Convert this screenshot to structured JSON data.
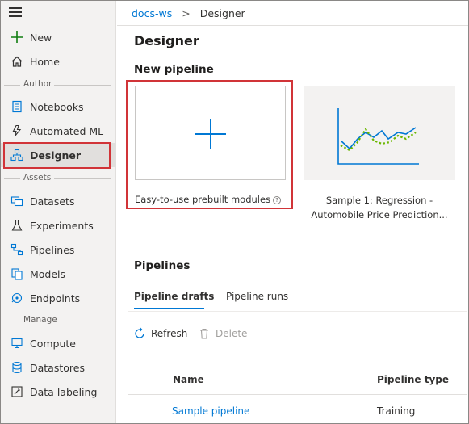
{
  "colors": {
    "accent": "#0078d4",
    "highlight": "#d13438",
    "sidebar_bg": "#f3f2f1",
    "chart_green": "#6bb700"
  },
  "sidebar": {
    "top_items": [
      {
        "label": "New",
        "icon": "plus-icon"
      },
      {
        "label": "Home",
        "icon": "home-icon"
      }
    ],
    "sections": [
      {
        "label": "Author",
        "items": [
          {
            "label": "Notebooks",
            "icon": "notebook-icon"
          },
          {
            "label": "Automated ML",
            "icon": "lightning-icon"
          },
          {
            "label": "Designer",
            "icon": "hierarchy-icon",
            "selected": true
          }
        ]
      },
      {
        "label": "Assets",
        "items": [
          {
            "label": "Datasets",
            "icon": "datasets-icon"
          },
          {
            "label": "Experiments",
            "icon": "flask-icon"
          },
          {
            "label": "Pipelines",
            "icon": "pipeline-icon"
          },
          {
            "label": "Models",
            "icon": "models-icon"
          },
          {
            "label": "Endpoints",
            "icon": "endpoints-icon"
          }
        ]
      },
      {
        "label": "Manage",
        "items": [
          {
            "label": "Compute",
            "icon": "compute-icon"
          },
          {
            "label": "Datastores",
            "icon": "database-icon"
          },
          {
            "label": "Data labeling",
            "icon": "labeling-icon"
          }
        ]
      }
    ]
  },
  "breadcrumb": {
    "workspace": "docs-ws",
    "separator": ">",
    "current": "Designer"
  },
  "main": {
    "title": "Designer",
    "new_pipeline": {
      "heading": "New pipeline",
      "prebuilt_label": "Easy-to-use prebuilt modules",
      "help_glyph": "?",
      "sample_label_line1": "Sample 1: Regression -",
      "sample_label_line2": "Automobile Price Prediction..."
    },
    "pipelines": {
      "heading": "Pipelines",
      "tabs": [
        "Pipeline drafts",
        "Pipeline runs"
      ],
      "active_tab": "Pipeline drafts",
      "commands": {
        "refresh": "Refresh",
        "delete": "Delete"
      },
      "table": {
        "columns": [
          "Name",
          "Pipeline type"
        ],
        "rows": [
          {
            "name": "Sample pipeline",
            "type": "Training"
          }
        ]
      }
    }
  }
}
